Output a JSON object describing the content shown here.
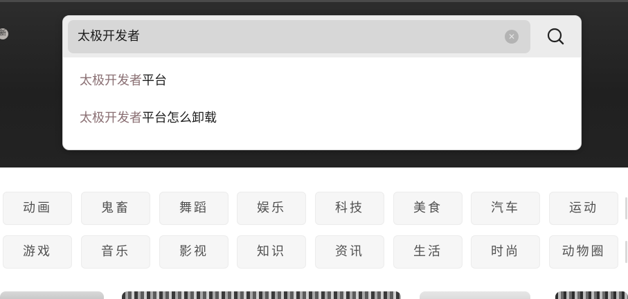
{
  "search": {
    "query": "太极开发者",
    "suggestions": [
      {
        "highlight": "太极开发者",
        "rest": "平台"
      },
      {
        "highlight": "太极开发者",
        "rest": "平台怎么卸载"
      }
    ]
  },
  "hero": {
    "edge_badge": "新"
  },
  "categories": {
    "row1": [
      "动画",
      "鬼畜",
      "舞蹈",
      "娱乐",
      "科技",
      "美食",
      "汽车",
      "运动"
    ],
    "row2": [
      "游戏",
      "音乐",
      "影视",
      "知识",
      "资讯",
      "生活",
      "时尚",
      "动物圈"
    ]
  },
  "icons": {
    "search": "search-icon",
    "clear": "clear-icon"
  },
  "colors": {
    "highlight": "#8a6f73",
    "hero_bg": "#222222"
  }
}
